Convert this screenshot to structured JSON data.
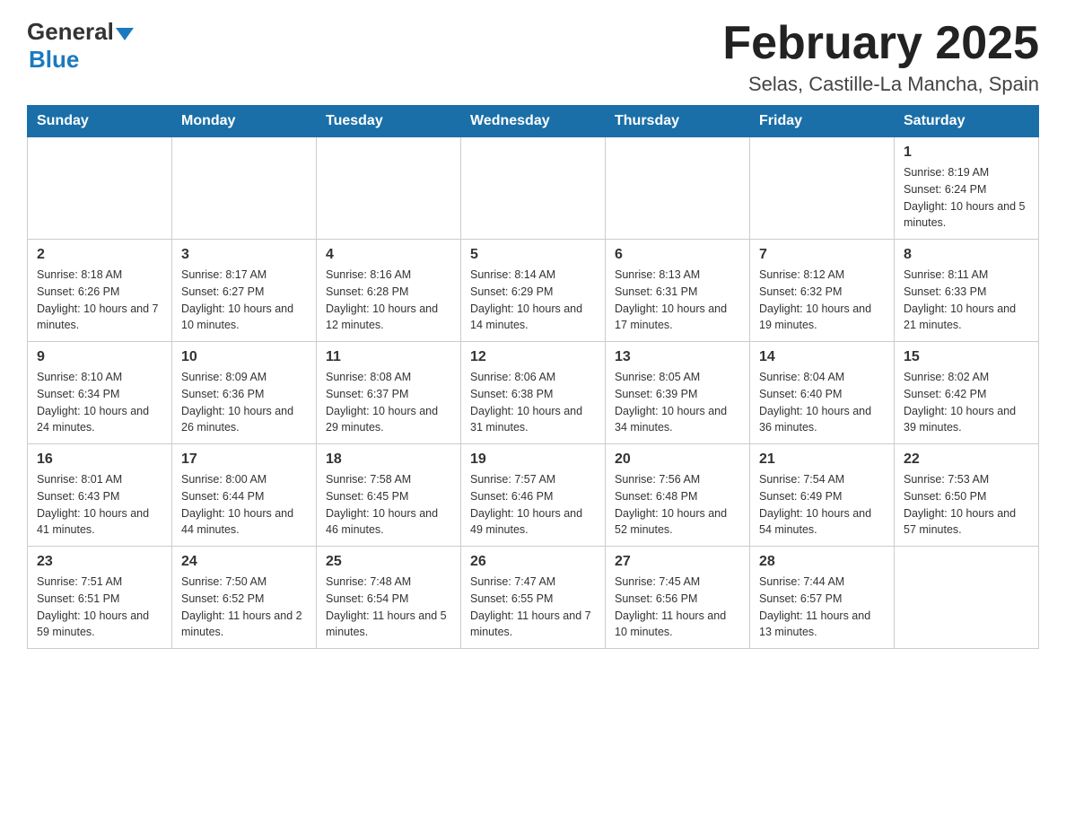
{
  "header": {
    "logo_general": "General",
    "logo_blue": "Blue",
    "month_title": "February 2025",
    "location": "Selas, Castille-La Mancha, Spain"
  },
  "weekdays": [
    "Sunday",
    "Monday",
    "Tuesday",
    "Wednesday",
    "Thursday",
    "Friday",
    "Saturday"
  ],
  "weeks": [
    [
      {
        "day": "",
        "info": ""
      },
      {
        "day": "",
        "info": ""
      },
      {
        "day": "",
        "info": ""
      },
      {
        "day": "",
        "info": ""
      },
      {
        "day": "",
        "info": ""
      },
      {
        "day": "",
        "info": ""
      },
      {
        "day": "1",
        "info": "Sunrise: 8:19 AM\nSunset: 6:24 PM\nDaylight: 10 hours and 5 minutes."
      }
    ],
    [
      {
        "day": "2",
        "info": "Sunrise: 8:18 AM\nSunset: 6:26 PM\nDaylight: 10 hours and 7 minutes."
      },
      {
        "day": "3",
        "info": "Sunrise: 8:17 AM\nSunset: 6:27 PM\nDaylight: 10 hours and 10 minutes."
      },
      {
        "day": "4",
        "info": "Sunrise: 8:16 AM\nSunset: 6:28 PM\nDaylight: 10 hours and 12 minutes."
      },
      {
        "day": "5",
        "info": "Sunrise: 8:14 AM\nSunset: 6:29 PM\nDaylight: 10 hours and 14 minutes."
      },
      {
        "day": "6",
        "info": "Sunrise: 8:13 AM\nSunset: 6:31 PM\nDaylight: 10 hours and 17 minutes."
      },
      {
        "day": "7",
        "info": "Sunrise: 8:12 AM\nSunset: 6:32 PM\nDaylight: 10 hours and 19 minutes."
      },
      {
        "day": "8",
        "info": "Sunrise: 8:11 AM\nSunset: 6:33 PM\nDaylight: 10 hours and 21 minutes."
      }
    ],
    [
      {
        "day": "9",
        "info": "Sunrise: 8:10 AM\nSunset: 6:34 PM\nDaylight: 10 hours and 24 minutes."
      },
      {
        "day": "10",
        "info": "Sunrise: 8:09 AM\nSunset: 6:36 PM\nDaylight: 10 hours and 26 minutes."
      },
      {
        "day": "11",
        "info": "Sunrise: 8:08 AM\nSunset: 6:37 PM\nDaylight: 10 hours and 29 minutes."
      },
      {
        "day": "12",
        "info": "Sunrise: 8:06 AM\nSunset: 6:38 PM\nDaylight: 10 hours and 31 minutes."
      },
      {
        "day": "13",
        "info": "Sunrise: 8:05 AM\nSunset: 6:39 PM\nDaylight: 10 hours and 34 minutes."
      },
      {
        "day": "14",
        "info": "Sunrise: 8:04 AM\nSunset: 6:40 PM\nDaylight: 10 hours and 36 minutes."
      },
      {
        "day": "15",
        "info": "Sunrise: 8:02 AM\nSunset: 6:42 PM\nDaylight: 10 hours and 39 minutes."
      }
    ],
    [
      {
        "day": "16",
        "info": "Sunrise: 8:01 AM\nSunset: 6:43 PM\nDaylight: 10 hours and 41 minutes."
      },
      {
        "day": "17",
        "info": "Sunrise: 8:00 AM\nSunset: 6:44 PM\nDaylight: 10 hours and 44 minutes."
      },
      {
        "day": "18",
        "info": "Sunrise: 7:58 AM\nSunset: 6:45 PM\nDaylight: 10 hours and 46 minutes."
      },
      {
        "day": "19",
        "info": "Sunrise: 7:57 AM\nSunset: 6:46 PM\nDaylight: 10 hours and 49 minutes."
      },
      {
        "day": "20",
        "info": "Sunrise: 7:56 AM\nSunset: 6:48 PM\nDaylight: 10 hours and 52 minutes."
      },
      {
        "day": "21",
        "info": "Sunrise: 7:54 AM\nSunset: 6:49 PM\nDaylight: 10 hours and 54 minutes."
      },
      {
        "day": "22",
        "info": "Sunrise: 7:53 AM\nSunset: 6:50 PM\nDaylight: 10 hours and 57 minutes."
      }
    ],
    [
      {
        "day": "23",
        "info": "Sunrise: 7:51 AM\nSunset: 6:51 PM\nDaylight: 10 hours and 59 minutes."
      },
      {
        "day": "24",
        "info": "Sunrise: 7:50 AM\nSunset: 6:52 PM\nDaylight: 11 hours and 2 minutes."
      },
      {
        "day": "25",
        "info": "Sunrise: 7:48 AM\nSunset: 6:54 PM\nDaylight: 11 hours and 5 minutes."
      },
      {
        "day": "26",
        "info": "Sunrise: 7:47 AM\nSunset: 6:55 PM\nDaylight: 11 hours and 7 minutes."
      },
      {
        "day": "27",
        "info": "Sunrise: 7:45 AM\nSunset: 6:56 PM\nDaylight: 11 hours and 10 minutes."
      },
      {
        "day": "28",
        "info": "Sunrise: 7:44 AM\nSunset: 6:57 PM\nDaylight: 11 hours and 13 minutes."
      },
      {
        "day": "",
        "info": ""
      }
    ]
  ]
}
